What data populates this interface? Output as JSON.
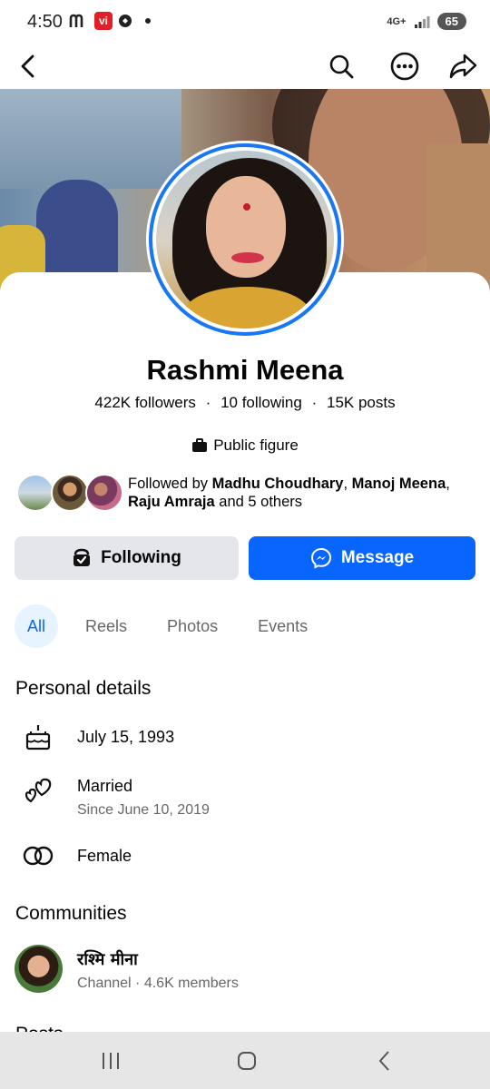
{
  "status_bar": {
    "time": "4:50",
    "network": "4G+",
    "battery": "65"
  },
  "top_bar": {
    "icons": [
      "back-arrow-icon",
      "search-icon",
      "more-icon",
      "share-icon"
    ]
  },
  "profile": {
    "name": "Rashmi Meena",
    "followers": "422K followers",
    "following": "10 following",
    "posts": "15K posts",
    "separator": "·",
    "category": "Public figure"
  },
  "followed_by": {
    "prefix": "Followed by ",
    "name1": "Madhu Choudhary",
    "sep1": ", ",
    "name2": "Manoj Meena",
    "sep2": ",",
    "name3": "Raju Amraja",
    "suffix": " and 5 others"
  },
  "actions": {
    "following_label": "Following",
    "message_label": "Message"
  },
  "tabs": [
    {
      "label": "All",
      "active": true
    },
    {
      "label": "Reels",
      "active": false
    },
    {
      "label": "Photos",
      "active": false
    },
    {
      "label": "Events",
      "active": false
    }
  ],
  "personal_details": {
    "title": "Personal details",
    "birthday": "July 15, 1993",
    "relationship": "Married",
    "relationship_since": "Since June 10, 2019",
    "gender": "Female"
  },
  "communities": {
    "title": "Communities",
    "items": [
      {
        "name": "रश्मि मीना",
        "meta": "Channel · 4.6K members"
      }
    ]
  },
  "cut_section_title": "Posts",
  "colors": {
    "accent": "#0866ff",
    "ring": "#1877f2",
    "secondary_button": "#e4e6eb",
    "active_tab_bg": "#e7f3ff",
    "muted_text": "#65676b"
  }
}
